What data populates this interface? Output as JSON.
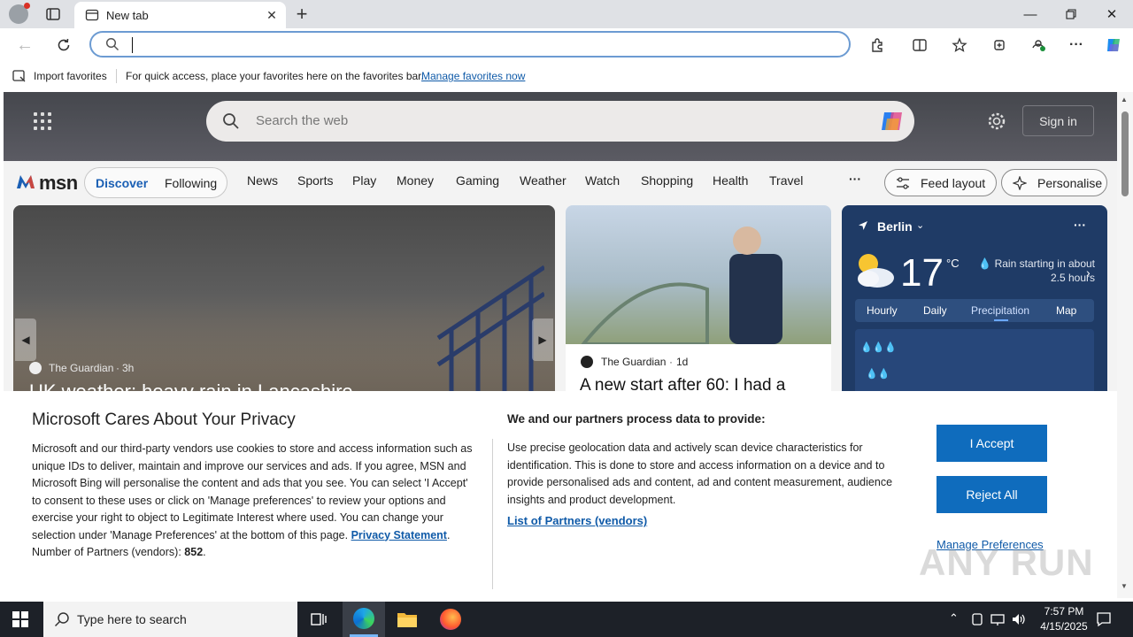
{
  "browser": {
    "tab_title": "New tab",
    "address_value": "",
    "favorites_bar": {
      "import_label": "Import favorites",
      "hint": "For quick access, place your favorites here on the favorites bar.",
      "manage_link": "Manage favorites now"
    }
  },
  "msn": {
    "search_placeholder": "Search the web",
    "sign_in": "Sign in",
    "logo_text": "msn",
    "tabs": [
      "Discover",
      "Following"
    ],
    "nav": [
      "News",
      "Sports",
      "Play",
      "Money",
      "Gaming",
      "Weather",
      "Watch",
      "Shopping",
      "Health",
      "Travel"
    ],
    "more": "···",
    "feed_layout": "Feed layout",
    "personalise": "Personalise",
    "cards": [
      {
        "source": "The Guardian",
        "age": "3h",
        "headline": "UK weather: heavy rain in Lancashire"
      },
      {
        "source": "The Guardian",
        "age": "1d",
        "headline": "A new start after 60: I had a"
      }
    ],
    "weather": {
      "city": "Berlin",
      "temp": "17",
      "unit": "°C",
      "summary": "Rain starting in about 2.5 hours",
      "tabs": [
        "Hourly",
        "Daily",
        "Precipitation",
        "Map"
      ],
      "active_tab": "Precipitation"
    }
  },
  "privacy": {
    "title": "Microsoft Cares About Your Privacy",
    "body": "Microsoft and our third-party vendors use cookies to store and access information such as unique IDs to deliver, maintain and improve our services and ads. If you agree, MSN and Microsoft Bing will personalise the content and ads that you see. You can select 'I Accept' to consent to these uses or click on 'Manage preferences' to review your options and exercise your right to object to Legitimate Interest where used.  You can change your selection under 'Manage Preferences' at the bottom of this page.",
    "statement_link": "Privacy Statement",
    "partners_label": "Number of Partners (vendors):",
    "partners_count": "852",
    "right_title": "We and our partners process data to provide:",
    "right_body": "Use precise geolocation data and actively scan device characteristics for identification. This is done to store and access information on a device and to provide personalised ads and content, ad and content measurement, audience insights and product development.",
    "partners_link": "List of Partners (vendors)",
    "accept": "I Accept",
    "reject": "Reject All",
    "manage": "Manage Preferences"
  },
  "watermark": "ANY RUN",
  "taskbar": {
    "search_placeholder": "Type here to search",
    "time": "7:57 PM",
    "date": "4/15/2025"
  },
  "colors": {
    "accent": "#0f6cbd",
    "msn_tab_active": "#1a5fb4",
    "taskbar": "#1d2128"
  }
}
